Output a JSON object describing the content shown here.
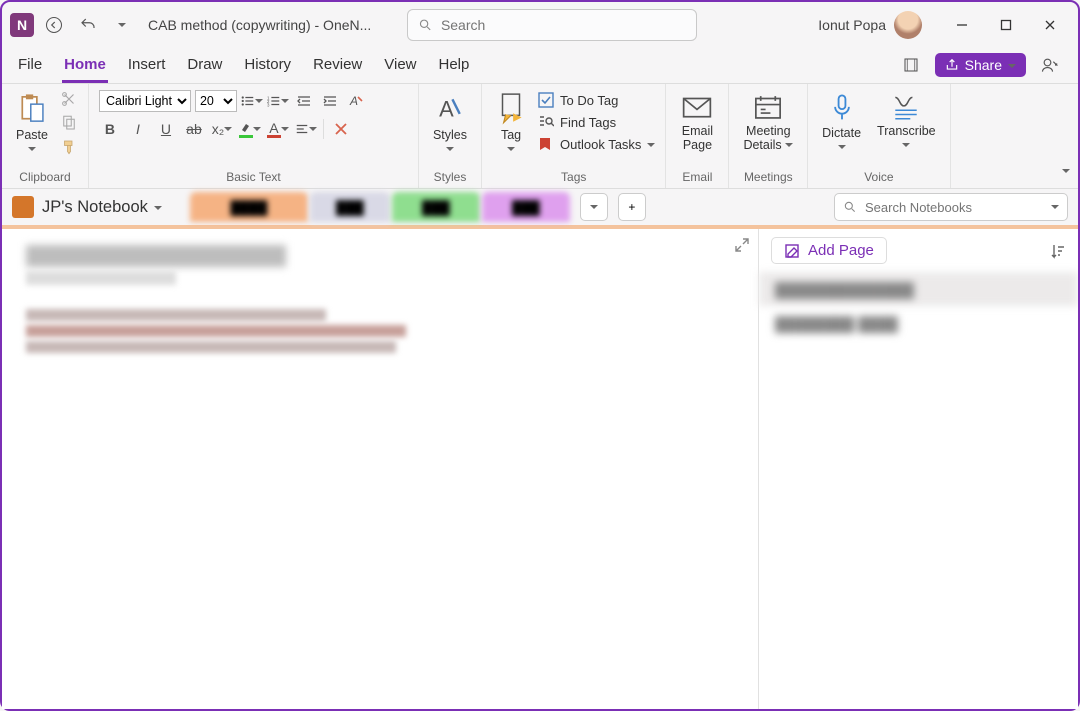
{
  "titlebar": {
    "document_title": "CAB method (copywriting)  -  OneN...",
    "search_placeholder": "Search",
    "username": "Ionut Popa"
  },
  "menu": {
    "items": [
      "File",
      "Home",
      "Insert",
      "Draw",
      "History",
      "Review",
      "View",
      "Help"
    ],
    "active_index": 1,
    "share_label": "Share"
  },
  "ribbon": {
    "clipboard": {
      "paste": "Paste",
      "label": "Clipboard"
    },
    "basic_text": {
      "label": "Basic Text",
      "font_name": "Calibri Light",
      "font_size": "20"
    },
    "styles": {
      "btn": "Styles",
      "label": "Styles"
    },
    "tags": {
      "tag_btn": "Tag",
      "todo": "To Do Tag",
      "find": "Find Tags",
      "outlook": "Outlook Tasks",
      "label": "Tags"
    },
    "email": {
      "btn_l1": "Email",
      "btn_l2": "Page",
      "label": "Email"
    },
    "meetings": {
      "btn_l1": "Meeting",
      "btn_l2": "Details",
      "label": "Meetings"
    },
    "voice": {
      "dictate": "Dictate",
      "transcribe": "Transcribe",
      "label": "Voice"
    }
  },
  "notebook": {
    "name": "JP's Notebook",
    "search_placeholder": "Search Notebooks",
    "section_tabs": [
      {
        "color": "orange"
      },
      {
        "color": "grey"
      },
      {
        "color": "green"
      },
      {
        "color": "purple"
      }
    ]
  },
  "sidepanel": {
    "add_page": "Add Page"
  }
}
